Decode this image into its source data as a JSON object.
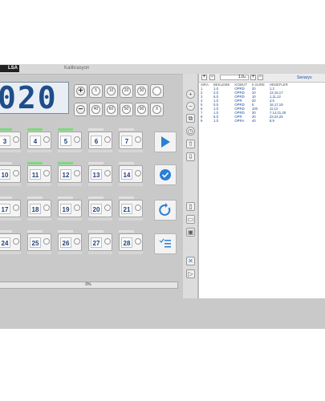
{
  "window": {
    "logo": "LSA",
    "title": "Kalibrasyon"
  },
  "display": {
    "value": "020"
  },
  "controls": {
    "top_row": [
      "+",
      "5",
      "10",
      "20",
      "30",
      ""
    ],
    "bottom_row": [
      "−",
      "40",
      "60",
      "50",
      "90",
      "X"
    ]
  },
  "grid": [
    [
      {
        "num": "3",
        "lit": true
      },
      {
        "num": "4",
        "lit": true
      },
      {
        "num": "5",
        "lit": true
      },
      {
        "num": "6",
        "lit": false
      },
      {
        "num": "7",
        "lit": false
      }
    ],
    [
      {
        "num": "10",
        "lit": false
      },
      {
        "num": "11",
        "lit": true
      },
      {
        "num": "12",
        "lit": true
      },
      {
        "num": "13",
        "lit": false
      },
      {
        "num": "14",
        "lit": false
      }
    ],
    [
      {
        "num": "17",
        "lit": false
      },
      {
        "num": "18",
        "lit": false
      },
      {
        "num": "19",
        "lit": false
      },
      {
        "num": "20",
        "lit": false
      },
      {
        "num": "21",
        "lit": false
      }
    ],
    [
      {
        "num": "24",
        "lit": false
      },
      {
        "num": "25",
        "lit": false
      },
      {
        "num": "26",
        "lit": false
      },
      {
        "num": "27",
        "lit": false
      },
      {
        "num": "28",
        "lit": false
      }
    ]
  ],
  "side_buttons": [
    {
      "icon": "play-icon"
    },
    {
      "icon": "check-icon"
    },
    {
      "icon": "reset-icon"
    },
    {
      "icon": "list-icon"
    }
  ],
  "progress": {
    "label": "0%",
    "fraction": 0
  },
  "list": {
    "step_value": "1.0",
    "step_unit": "sn",
    "panel_title": "Senaryo",
    "columns": [
      "SIRA",
      "BEKLEME",
      "KOMUT",
      "K.SURE",
      "HEDEFLER"
    ],
    "rows": [
      [
        "1",
        "1.0",
        "OPRD",
        "20",
        "1,2"
      ],
      [
        "2",
        "2.0",
        "OPRD",
        "10",
        "13,16,17"
      ],
      [
        "3",
        "5.0",
        "OPRD",
        "10",
        "1,11,12"
      ],
      [
        "4",
        "1.0",
        "OPR",
        "20",
        "4,5"
      ],
      [
        "5",
        "0.5",
        "OPRD",
        "5",
        "16,17,18"
      ],
      [
        "6",
        "1.0",
        "OPRD",
        "100",
        "11,12"
      ],
      [
        "7",
        "1.0",
        "OPRD",
        "30",
        "7,14,21,28"
      ],
      [
        "8",
        "6.0",
        "OPR",
        "20",
        "23,24,25"
      ],
      [
        "9",
        "1.0",
        "OPRA",
        "40",
        "8,9"
      ]
    ]
  }
}
